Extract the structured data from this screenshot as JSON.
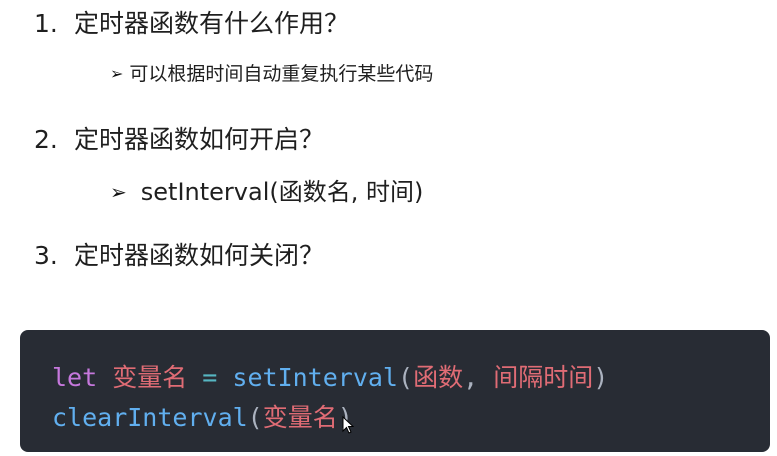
{
  "questions": [
    {
      "number": "1.",
      "text": "定时器函数有什么作用？"
    },
    {
      "number": "2.",
      "text": "定时器函数如何开启？"
    },
    {
      "number": "3.",
      "text": "定时器函数如何关闭？"
    }
  ],
  "answers": {
    "a1": {
      "bullet": "➢",
      "text": "可以根据时间自动重复执行某些代码"
    },
    "a2": {
      "bullet": "➢",
      "text": "setInterval(函数名, 时间)"
    }
  },
  "code": {
    "line1": {
      "keyword": "let",
      "var_name": "变量名",
      "operator": "=",
      "func": "setInterval",
      "open_paren": "(",
      "arg1": "函数",
      "comma": ",",
      "arg2": "间隔时间",
      "close_paren": ")"
    },
    "line2": {
      "func": "clearInterval",
      "open_paren": "(",
      "arg": "变量名",
      "close_paren": ")"
    }
  },
  "colors": {
    "code_bg": "#282c34",
    "keyword": "#c678dd",
    "variable": "#e06c75",
    "operator": "#56b6c2",
    "function": "#61afef",
    "punctuation": "#abb2bf"
  },
  "icons": {
    "cursor": "mouse-pointer-icon"
  }
}
